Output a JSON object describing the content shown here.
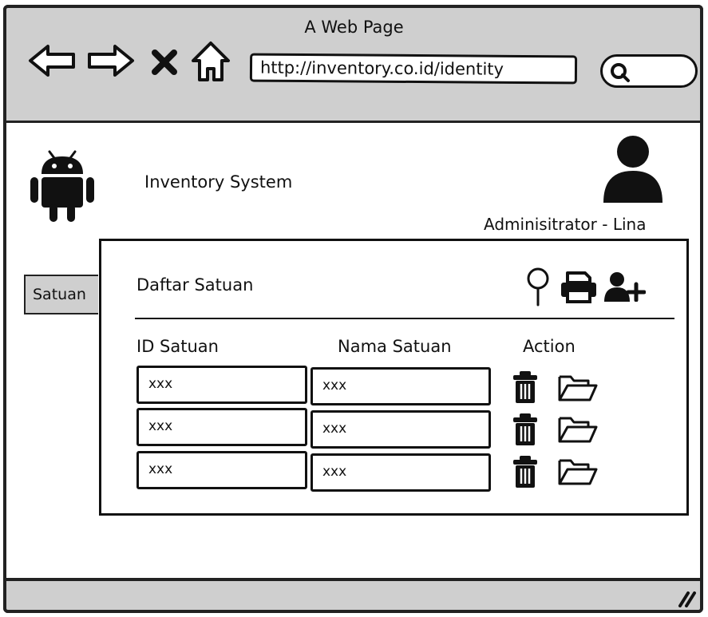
{
  "browser": {
    "window_title": "A Web Page",
    "url": "http://inventory.co.id/identity",
    "icons": [
      "back-arrow-icon",
      "forward-arrow-icon",
      "close-x-icon",
      "home-icon",
      "search-icon"
    ]
  },
  "header": {
    "app_name": "Inventory System",
    "logo_icon": "android-icon",
    "user_icon": "user-avatar-icon",
    "user_label": "Adminisitrator - Lina"
  },
  "sidebar": {
    "items": [
      {
        "label": "Satuan"
      }
    ]
  },
  "panel": {
    "title": "Daftar Satuan",
    "toolbar_icons": [
      "search-icon",
      "print-icon",
      "add-user-icon"
    ],
    "columns": [
      "ID Satuan",
      "Nama Satuan",
      "Action"
    ],
    "rows": [
      {
        "id": "xxx",
        "name": "xxx"
      },
      {
        "id": "xxx",
        "name": "xxx"
      },
      {
        "id": "xxx",
        "name": "xxx"
      }
    ],
    "row_action_icons": [
      "trash-icon",
      "folder-open-icon"
    ]
  },
  "colors": {
    "chrome_gray": "#cfcfcf",
    "ink": "#111111"
  }
}
